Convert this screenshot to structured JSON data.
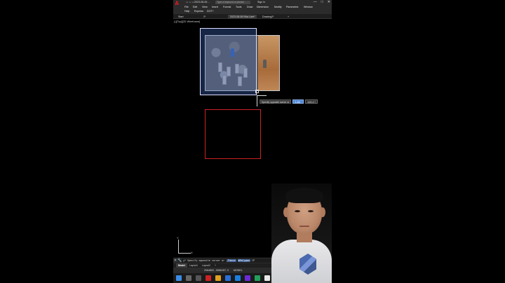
{
  "app": {
    "logo_letter": "A",
    "quick_access": "▭ ▭ ▭",
    "filename": "2023-08-06 ...",
    "search_placeholder": "Type a keyword or phrase",
    "sign_in": "Sign In",
    "window_controls": [
      "—",
      "□",
      "✕"
    ]
  },
  "menu": {
    "row1": [
      "File",
      "Edit",
      "View",
      "Insert",
      "Format",
      "Tools",
      "Draw",
      "Dimension",
      "Modify",
      "Parametric",
      "Window"
    ],
    "row2": [
      "Help",
      "Express",
      "DOT+"
    ]
  },
  "tabs": [
    "Start",
    "2*",
    "2023-08-06 Nha Lam*",
    "Drawing2*",
    "+"
  ],
  "viewport_label": "[-][Top][2D Wireframe]",
  "dynamic_input": {
    "prompt": "Specify opposite corner or",
    "value1": "3.4M",
    "value2": "5881KT"
  },
  "ucs": {
    "x": "X",
    "y": "Y"
  },
  "command_line": {
    "text": "□* Specify opposite corner or [",
    "option1": "Fence",
    "option2": "WPolygon",
    "suffix": "CP"
  },
  "layout_tabs": [
    "Model",
    "Layout1",
    "Layout2",
    "+"
  ],
  "status": {
    "coords": "2064802, -5066157, 0",
    "mode": "MODEL"
  },
  "colors": {
    "accent_red": "#e31b23",
    "selection_blue": "#466ec8",
    "rect_red": "#cc2222"
  }
}
